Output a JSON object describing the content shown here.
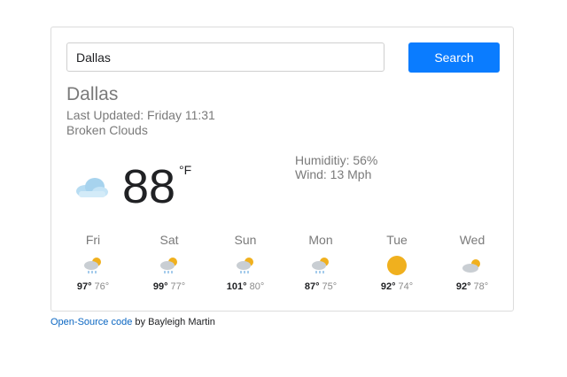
{
  "search": {
    "value": "Dallas",
    "button_label": "Search"
  },
  "current": {
    "city": "Dallas",
    "updated": "Last Updated: Friday 11:31",
    "condition": "Broken Clouds",
    "icon": "cloud-icon",
    "temperature": "88",
    "unit": "°F",
    "humidity": "Humiditiy: 56%",
    "wind": "Wind: 13 Mph"
  },
  "forecast": [
    {
      "day": "Fri",
      "high": "97°",
      "low": "76°",
      "icon": "rain-sun-icon"
    },
    {
      "day": "Sat",
      "high": "99°",
      "low": "77°",
      "icon": "rain-sun-icon"
    },
    {
      "day": "Sun",
      "high": "101°",
      "low": "80°",
      "icon": "rain-sun-icon"
    },
    {
      "day": "Mon",
      "high": "87°",
      "low": "75°",
      "icon": "rain-sun-icon"
    },
    {
      "day": "Tue",
      "high": "92°",
      "low": "74°",
      "icon": "sun-icon"
    },
    {
      "day": "Wed",
      "high": "92°",
      "low": "78°",
      "icon": "partly-cloudy-icon"
    }
  ],
  "footer": {
    "link_text": "Open-Source code",
    "suffix": " by Bayleigh Martin"
  },
  "colors": {
    "accent": "#0a7cff",
    "sun": "#f0b01e",
    "link": "#0a66c2"
  }
}
